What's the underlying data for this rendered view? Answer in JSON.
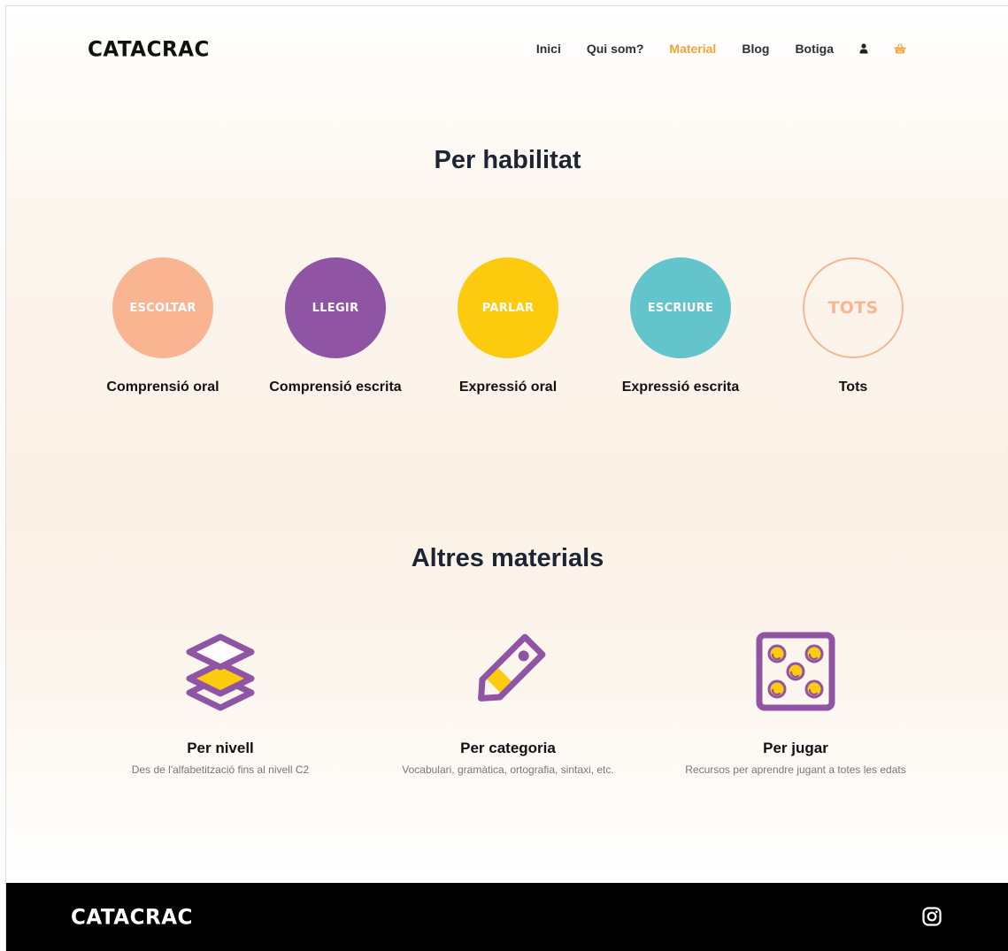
{
  "header": {
    "logo": "CATACRAC",
    "nav": [
      {
        "label": "Inici"
      },
      {
        "label": "Qui som?"
      },
      {
        "label": "Material",
        "active": true
      },
      {
        "label": "Blog"
      },
      {
        "label": "Botiga"
      }
    ],
    "icons": [
      "user-icon",
      "cart-icon"
    ],
    "accent_color": "#f2a23c"
  },
  "skills_section": {
    "title": "Per habilitat",
    "items": [
      {
        "circle_text": "ESCOLTAR",
        "label": "Comprensió oral",
        "color": "#f9b491"
      },
      {
        "circle_text": "LLEGIR",
        "label": "Comprensió escrita",
        "color": "#8f54a3"
      },
      {
        "circle_text": "PARLAR",
        "label": "Expressió oral",
        "color": "#fccb0e"
      },
      {
        "circle_text": "ESCRIURE",
        "label": "Expressió escrita",
        "color": "#63c5cb"
      },
      {
        "circle_text": "TOTS",
        "label": "Tots",
        "color": "#f7b593"
      }
    ]
  },
  "materials_section": {
    "title": "Altres materials",
    "items": [
      {
        "icon": "layers-icon",
        "title": "Per nivell",
        "description": "Des de l'alfabetització fins al nivell C2"
      },
      {
        "icon": "tag-icon",
        "title": "Per categoria",
        "description": "Vocabulari, gramàtica, ortografia, sintaxi, etc."
      },
      {
        "icon": "dice-icon",
        "title": "Per jugar",
        "description": "Recursos per aprendre jugant a totes les edats"
      }
    ],
    "icon_colors": {
      "primary": "#8f54a3",
      "secondary": "#fccb0e"
    }
  },
  "footer": {
    "logo": "CATACRAC",
    "icons": [
      "instagram-icon"
    ]
  }
}
